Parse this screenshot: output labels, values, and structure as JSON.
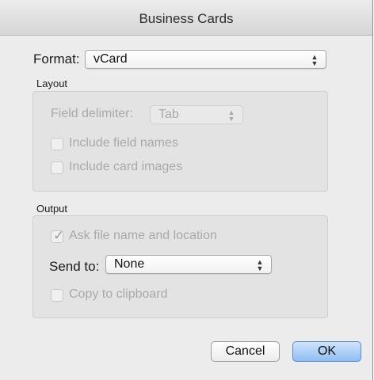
{
  "window": {
    "title": "Business Cards"
  },
  "format": {
    "label": "Format:",
    "value": "vCard"
  },
  "layout": {
    "group_label": "Layout",
    "field_delimiter_label": "Field delimiter:",
    "field_delimiter_value": "Tab",
    "include_field_names_label": "Include field names",
    "include_field_names_checked": false,
    "include_card_images_label": "Include card images",
    "include_card_images_checked": false
  },
  "output": {
    "group_label": "Output",
    "ask_file_label": "Ask file name and location",
    "ask_file_checked": true,
    "ask_file_mark": "✓",
    "send_to_label": "Send to:",
    "send_to_value": "None",
    "copy_clipboard_label": "Copy to clipboard",
    "copy_clipboard_checked": false
  },
  "buttons": {
    "cancel": "Cancel",
    "ok": "OK"
  },
  "icons": {
    "popup_arrows": "up-down-chevron-icon"
  },
  "colors": {
    "default_button": "#8fbdf1",
    "disabled_text": "#a9a9a9"
  }
}
